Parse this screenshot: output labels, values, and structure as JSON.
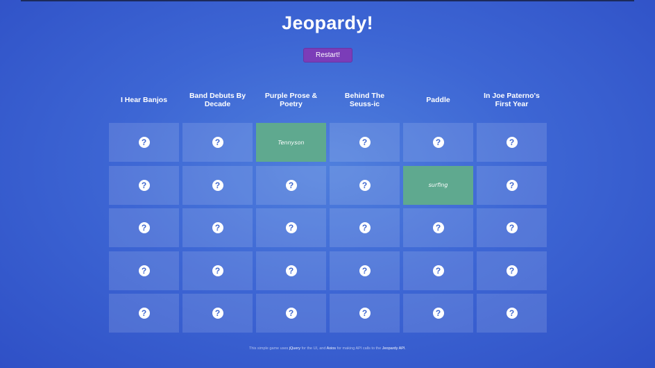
{
  "title": "Jeopardy!",
  "restart_label": "Restart!",
  "categories": [
    "I Hear Banjos",
    "Band Debuts By Decade",
    "Purple Prose & Poetry",
    "Behind The Seuss-ic",
    "Paddle",
    "In Joe Paterno's First Year"
  ],
  "question_icon": "?",
  "board": [
    [
      {
        "state": "hidden"
      },
      {
        "state": "hidden"
      },
      {
        "state": "answer",
        "text": "Tennyson"
      },
      {
        "state": "hidden"
      },
      {
        "state": "hidden"
      },
      {
        "state": "hidden"
      }
    ],
    [
      {
        "state": "hidden"
      },
      {
        "state": "hidden"
      },
      {
        "state": "hidden"
      },
      {
        "state": "hidden"
      },
      {
        "state": "answer",
        "text": "surfing"
      },
      {
        "state": "hidden"
      }
    ],
    [
      {
        "state": "hidden"
      },
      {
        "state": "hidden"
      },
      {
        "state": "hidden"
      },
      {
        "state": "hidden"
      },
      {
        "state": "hidden"
      },
      {
        "state": "hidden"
      }
    ],
    [
      {
        "state": "hidden"
      },
      {
        "state": "hidden"
      },
      {
        "state": "hidden"
      },
      {
        "state": "hidden"
      },
      {
        "state": "hidden"
      },
      {
        "state": "hidden"
      }
    ],
    [
      {
        "state": "hidden"
      },
      {
        "state": "hidden"
      },
      {
        "state": "hidden"
      },
      {
        "state": "hidden"
      },
      {
        "state": "hidden"
      },
      {
        "state": "hidden"
      }
    ]
  ],
  "footer": {
    "part1": "This simple game uses ",
    "link1": "jQuery",
    "part2": " for the UI, and ",
    "link2": "Axios",
    "part3": " for making API calls to the ",
    "link3": "Jeopardy API",
    "part4": "."
  },
  "colors": {
    "background": "#3d66d4",
    "restart_button": "#7b3db8",
    "revealed_cell": "#5fa98f"
  }
}
